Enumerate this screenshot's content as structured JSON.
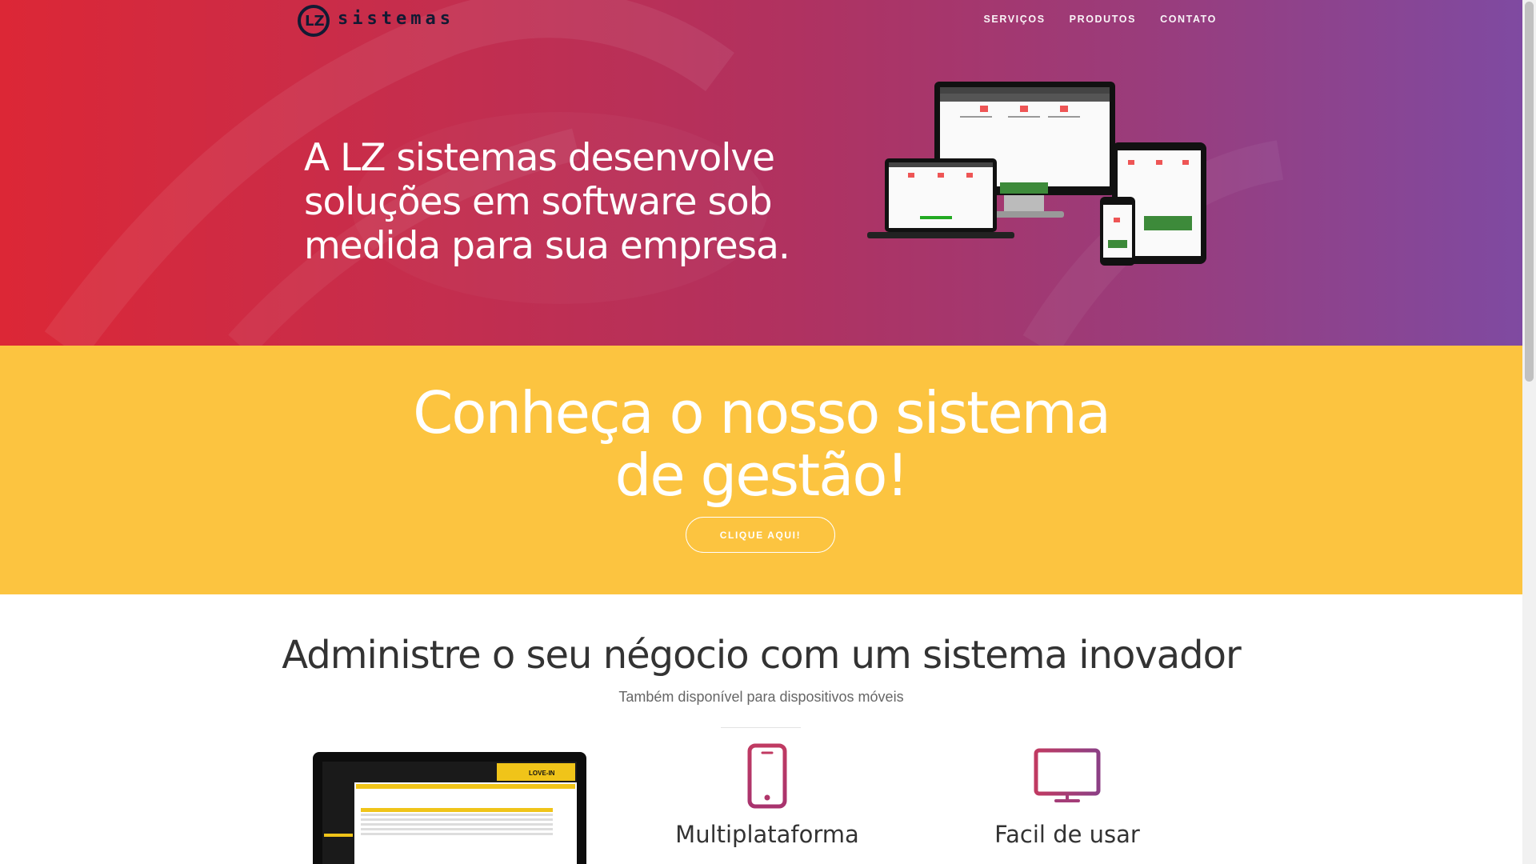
{
  "brand": {
    "name": "sistemas",
    "mark": "LZ"
  },
  "nav": {
    "items": [
      "SERVIÇOS",
      "PRODUTOS",
      "CONTATO"
    ]
  },
  "hero": {
    "heading": "A LZ sistemas desenvolve soluções em software sob medida para sua empresa."
  },
  "cta": {
    "heading_line1": "Conheça o nosso sistema",
    "heading_line2": "de gestão!",
    "button": "CLIQUE AQUI!"
  },
  "features": {
    "heading": "Administre o seu négocio com um sistema inovador",
    "subheading": "Também disponível para dispositivos móveis",
    "items": [
      {
        "title": "Multiplataforma",
        "icon": "smartphone-icon"
      },
      {
        "title": "Facil de usar",
        "icon": "monitor-icon"
      }
    ]
  },
  "preview": {
    "product_label": "LOVE-IN"
  },
  "colors": {
    "hero_start": "#dc2736",
    "hero_end": "#7f4aa1",
    "cta_bg": "#fcc440",
    "icon_pink": "#c03a62",
    "icon_purple": "#8c3f85"
  }
}
